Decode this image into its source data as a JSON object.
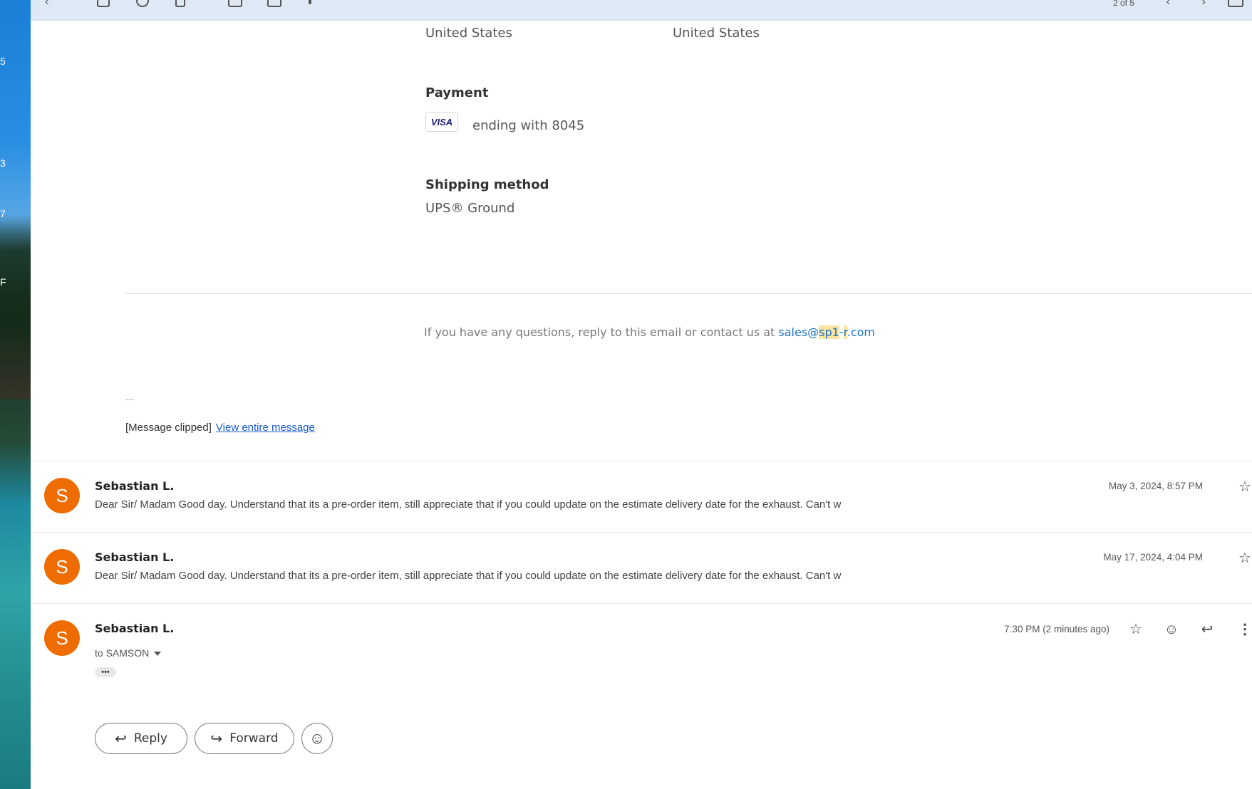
{
  "desktop": {
    "numbers": [
      "5",
      "3",
      "7",
      "F"
    ]
  },
  "toolbar": {
    "counter": "2 of 5",
    "icons": [
      "back-icon",
      "archive-icon",
      "report-spam-icon",
      "delete-icon",
      "mark-unread-icon",
      "move-to-icon",
      "more-icon",
      "prev-icon",
      "next-icon",
      "keyboard-icon"
    ]
  },
  "order": {
    "addresses": [
      "United States",
      "United States"
    ],
    "payment_heading": "Payment",
    "card_brand": "VISA",
    "card_text": "ending with 8045",
    "shipping_heading": "Shipping method",
    "shipping_value": "UPS® Ground",
    "contact_prefix": "If you have any questions, reply to this email or contact us at ",
    "contact_email_parts": [
      "sales@",
      "sp1",
      "-",
      "r",
      ".com"
    ]
  },
  "clip": {
    "ellipsis": "...",
    "clipped_label": "[Message clipped]",
    "view_link": "View entire message"
  },
  "messages": [
    {
      "avatar": "S",
      "sender": "Sebastian L.",
      "snippet": "Dear Sir/ Madam Good day. Understand that its a pre-order item, still appreciate that if you could update on the estimate delivery date for the exhaust. Can't w",
      "date": "May 3, 2024, 8:57 PM"
    },
    {
      "avatar": "S",
      "sender": "Sebastian L.",
      "snippet": "Dear Sir/ Madam Good day. Understand that its a pre-order item, still appreciate that if you could update on the estimate delivery date for the exhaust. Can't w",
      "date": "May 17, 2024, 4:04 PM"
    },
    {
      "avatar": "S",
      "sender": "Sebastian L.",
      "to": "to SAMSON",
      "date": "7:30 PM (2 minutes ago)",
      "dots": "•••"
    }
  ],
  "actions": {
    "reply": "Reply",
    "forward": "Forward"
  },
  "colors": {
    "avatar": "#ef6c00",
    "link": "#1a5bd6",
    "email_link": "#1a73c8",
    "highlight": "#fbe3a0",
    "toolbar": "#dfe8f5"
  }
}
